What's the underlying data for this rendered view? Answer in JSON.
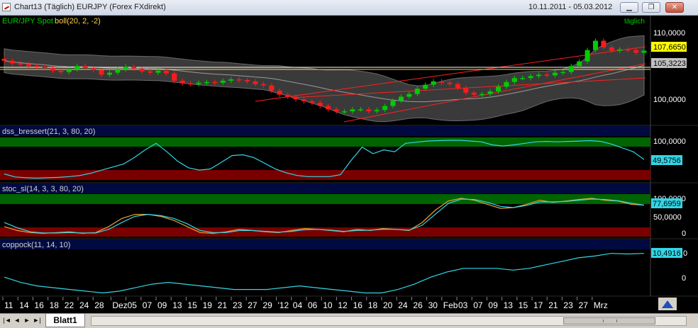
{
  "window": {
    "title": "Chart13 (Täglich)  EURJPY (Forex FXdirekt)",
    "date_range": "10.11.2011 - 05.03.2012",
    "minimize_symbol": "▁",
    "restore_symbol": "❐",
    "close_symbol": "✕"
  },
  "panels": {
    "price": {
      "label_symbol": "EUR/JPY Spot",
      "label_indicator": "boll(20, 2, -2)",
      "interval": "täglich",
      "axis_ticks": [
        "110,0000",
        "100,0000"
      ],
      "last_price": "107,6650",
      "mid_band": "105,3223"
    },
    "dss": {
      "label": "dss_bressert(21, 3, 80, 20)",
      "axis_top": "100,0000",
      "value": "49,5756"
    },
    "stoc": {
      "label": "stoc_sl(14, 3, 3, 80, 20)",
      "axis_ticks": [
        "100,0000",
        "50,0000",
        "0"
      ],
      "value": "77,6959"
    },
    "coppock": {
      "label": "coppock(11, 14, 10)",
      "axis_ticks": [
        "0"
      ],
      "value": "10,4916",
      "value_suffix": "0"
    }
  },
  "x_axis_labels": [
    "11",
    "14",
    "16",
    "18",
    "22",
    "24",
    "28",
    "Dez",
    "05",
    "07",
    "09",
    "13",
    "15",
    "19",
    "21",
    "23",
    "27",
    "29",
    "'12",
    "04",
    "06",
    "10",
    "12",
    "16",
    "18",
    "20",
    "24",
    "26",
    "30",
    "Feb",
    "03",
    "07",
    "09",
    "13",
    "15",
    "17",
    "21",
    "23",
    "27",
    "Mrz"
  ],
  "sheet_tab": "Blatt1",
  "colors": {
    "bull": "#00cc00",
    "bear": "#ff1a1a",
    "cyan": "#33d6e6",
    "orange": "#e8a030",
    "upper_zone": "#006400",
    "lower_zone": "#7a0000"
  },
  "chart_data": [
    {
      "type": "candlestick",
      "title": "EUR/JPY Spot boll(20, 2, -2)",
      "y_ticks": [
        100,
        110
      ],
      "close": [
        106.2,
        105.8,
        105.7,
        105.4,
        105.3,
        105.1,
        104.7,
        104.5,
        104.9,
        105.4,
        105.1,
        104.8,
        104.1,
        104.4,
        104.9,
        105.3,
        105.0,
        104.6,
        104.4,
        104.7,
        104.3,
        103.2,
        102.8,
        102.7,
        102.9,
        103.0,
        102.9,
        103.2,
        103.4,
        103.3,
        103.1,
        102.7,
        102.5,
        101.7,
        101.1,
        100.8,
        100.4,
        100.1,
        99.9,
        99.4,
        98.9,
        98.6,
        98.6,
        98.9,
        98.9,
        98.6,
        98.8,
        99.4,
        100.2,
        100.8,
        101.2,
        102.0,
        102.6,
        103.1,
        102.9,
        102.7,
        102.1,
        101.4,
        101.1,
        101.2,
        101.6,
        102.3,
        103.0,
        103.6,
        103.6,
        103.9,
        104.1,
        104.0,
        104.4,
        104.5,
        105.4,
        106.1,
        107.8,
        109.2,
        108.2,
        107.7,
        107.9,
        107.8,
        107.4,
        107.7
      ]
    },
    {
      "type": "line",
      "title": "dss_bressert(21, 3, 80, 20)",
      "ylim": [
        0,
        100
      ],
      "series": [
        {
          "values": [
            12,
            4,
            2,
            1,
            2,
            3,
            5,
            8,
            14,
            22,
            30,
            38,
            55,
            75,
            92,
            70,
            45,
            28,
            22,
            25,
            42,
            60,
            62,
            55,
            40,
            25,
            15,
            8,
            5,
            5,
            5,
            10,
            48,
            82,
            65,
            75,
            70,
            92,
            95,
            98,
            99,
            100,
            100,
            98,
            96,
            88,
            85,
            88,
            92,
            96,
            97,
            96,
            97,
            98,
            99,
            97,
            90,
            80,
            70,
            49.6
          ]
        }
      ]
    },
    {
      "type": "line",
      "title": "stoc_sl(14, 3, 3, 80, 20)",
      "ylim": [
        0,
        100
      ],
      "series": [
        {
          "values": [
            25,
            15,
            10,
            8,
            10,
            12,
            8,
            10,
            25,
            45,
            55,
            55,
            50,
            40,
            25,
            10,
            8,
            12,
            18,
            15,
            12,
            10,
            15,
            20,
            18,
            15,
            12,
            18,
            15,
            20,
            18,
            15,
            35,
            65,
            88,
            95,
            90,
            80,
            70,
            72,
            80,
            90,
            85,
            88,
            92,
            95,
            90,
            88,
            80,
            77.7
          ]
        },
        {
          "values": [
            35,
            22,
            12,
            9,
            9,
            10,
            9,
            9,
            18,
            35,
            50,
            55,
            52,
            45,
            32,
            15,
            10,
            10,
            15,
            15,
            13,
            11,
            13,
            17,
            18,
            16,
            13,
            15,
            16,
            18,
            18,
            16,
            28,
            55,
            82,
            93,
            92,
            85,
            75,
            72,
            77,
            86,
            86,
            87,
            90,
            93,
            92,
            89,
            83,
            78
          ]
        }
      ]
    },
    {
      "type": "line",
      "title": "coppock(11, 14, 10)",
      "series": [
        {
          "values": [
            -3,
            -6,
            -8,
            -9,
            -10,
            -11,
            -12,
            -11,
            -9,
            -7,
            -6,
            -7,
            -8,
            -9,
            -10,
            -10,
            -10,
            -9,
            -8,
            -9,
            -10,
            -11,
            -12,
            -12,
            -10,
            -7,
            -3,
            0,
            2,
            2,
            2,
            1,
            2,
            4,
            6,
            8,
            9,
            10.5,
            10.2,
            10.5
          ]
        }
      ]
    }
  ]
}
